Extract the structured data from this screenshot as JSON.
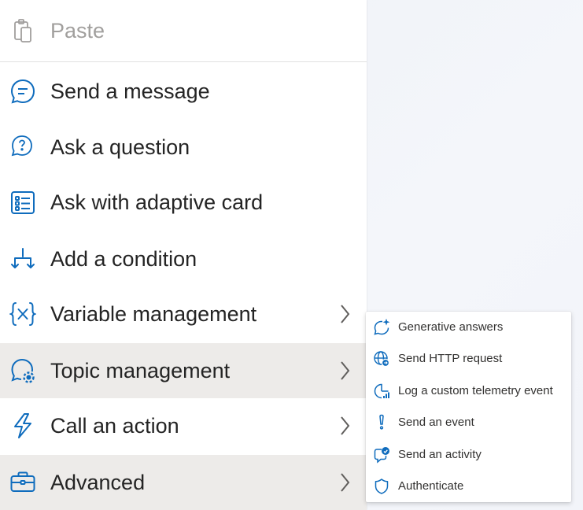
{
  "colors": {
    "accent": "#0f6cbd",
    "active_row": "#edebe9",
    "disabled_text": "#a19f9d"
  },
  "menu": {
    "paste": {
      "label": "Paste",
      "icon": "clipboard-icon"
    },
    "items": [
      {
        "label": "Send a message",
        "icon": "chat-bubble-icon",
        "submenu": false
      },
      {
        "label": "Ask a question",
        "icon": "question-bubble-icon",
        "submenu": false
      },
      {
        "label": "Ask with adaptive card",
        "icon": "adaptive-card-icon",
        "submenu": false
      },
      {
        "label": "Add a condition",
        "icon": "branch-icon",
        "submenu": false
      },
      {
        "label": "Variable management",
        "icon": "variable-icon",
        "submenu": true
      },
      {
        "label": "Topic management",
        "icon": "topic-settings-icon",
        "submenu": true,
        "active": true
      },
      {
        "label": "Call an action",
        "icon": "lightning-icon",
        "submenu": true
      },
      {
        "label": "Advanced",
        "icon": "briefcase-icon",
        "submenu": true,
        "active": true
      }
    ]
  },
  "submenu": {
    "items": [
      {
        "label": "Generative answers",
        "icon": "sparkle-bubble-icon"
      },
      {
        "label": "Send HTTP request",
        "icon": "globe-icon"
      },
      {
        "label": "Log a custom telemetry event",
        "icon": "telemetry-chart-icon"
      },
      {
        "label": "Send an event",
        "icon": "exclamation-icon"
      },
      {
        "label": "Send an activity",
        "icon": "activity-bubble-icon"
      },
      {
        "label": "Authenticate",
        "icon": "shield-icon"
      }
    ]
  }
}
